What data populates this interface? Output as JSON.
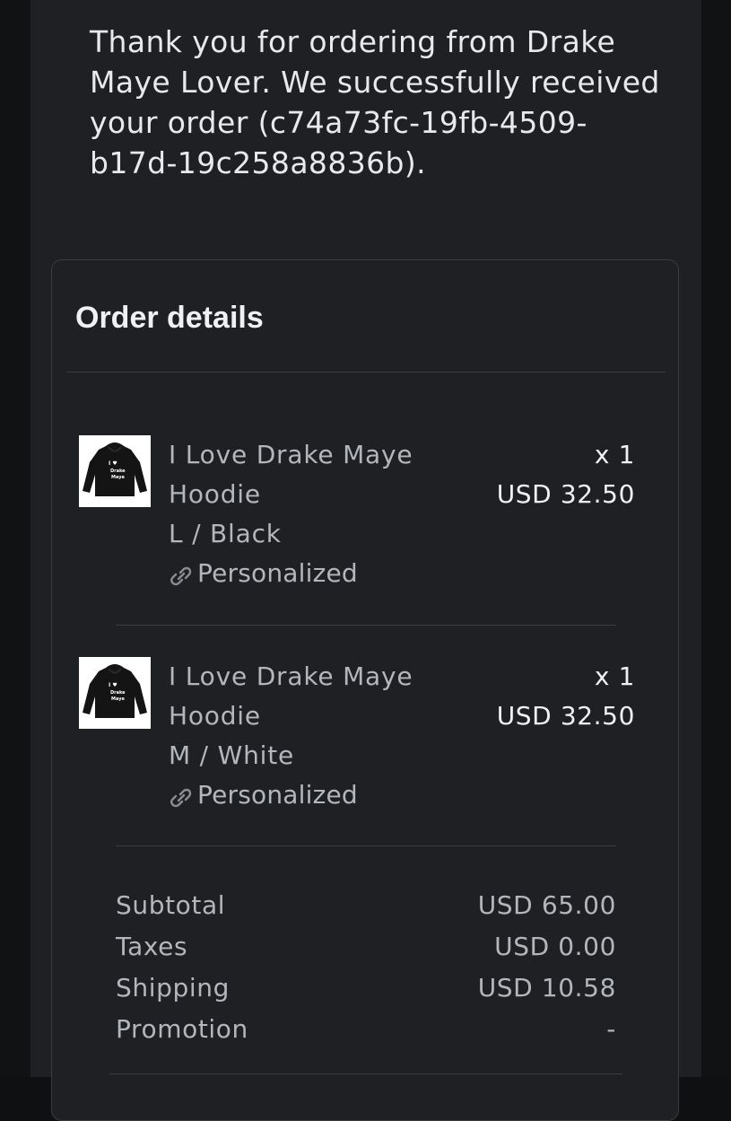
{
  "intro": {
    "text": "Thank you for ordering from Drake Maye Lover. We successfully received your order (c74a73fc-19fb-4509-b17d-19c258a8836b)."
  },
  "order": {
    "title": "Order details",
    "items": [
      {
        "name_line1": "I Love Drake Maye",
        "name_line2": "Hoodie",
        "variant": "L / Black",
        "personalized_label": "Personalized",
        "quantity": "x 1",
        "price": "USD 32.50",
        "thumb_icon": "hoodie-thumbnail",
        "thumb_text": [
          "I ♥",
          "Drake",
          "Maye"
        ]
      },
      {
        "name_line1": "I Love Drake Maye",
        "name_line2": "Hoodie",
        "variant": "M / White",
        "personalized_label": "Personalized",
        "quantity": "x 1",
        "price": "USD 32.50",
        "thumb_icon": "hoodie-thumbnail",
        "thumb_text": [
          "I ♥",
          "Drake",
          "Maye"
        ]
      }
    ],
    "totals": [
      {
        "label": "Subtotal",
        "value": "USD 65.00"
      },
      {
        "label": "Taxes",
        "value": "USD 0.00"
      },
      {
        "label": "Shipping",
        "value": "USD 10.58"
      },
      {
        "label": "Promotion",
        "value": "-"
      }
    ]
  },
  "colors": {
    "background": "#111213",
    "panel": "#1f2023",
    "text_primary": "#eef0f3",
    "text_secondary": "#b3b6bb",
    "divider": "#3a3c40",
    "heart_red": "#e0242b"
  }
}
